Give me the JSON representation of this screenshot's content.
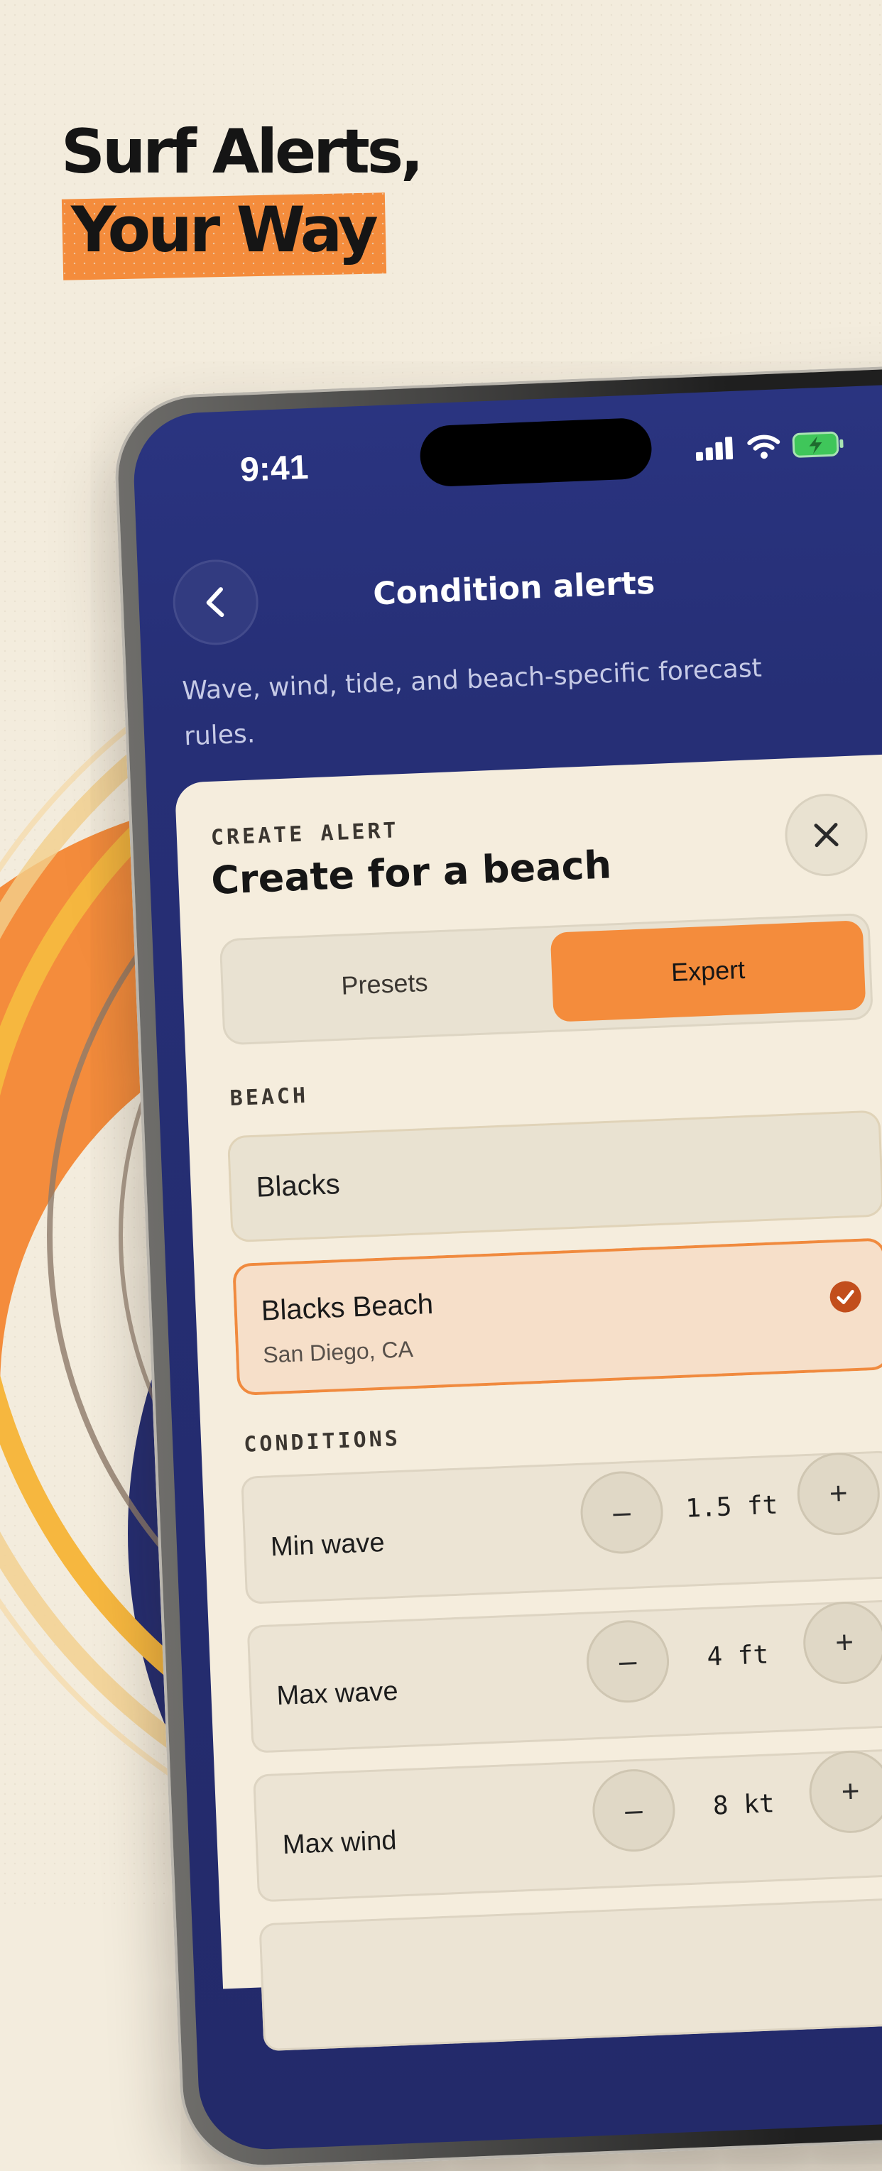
{
  "headline": {
    "line1": "Surf Alerts,",
    "line2": "Your Way"
  },
  "status_bar": {
    "time": "9:41"
  },
  "nav": {
    "title": "Condition alerts"
  },
  "subtitle": "Wave, wind, tide, and beach-specific forecast rules.",
  "sheet": {
    "label": "CREATE ALERT",
    "title": "Create for a beach",
    "tabs": [
      {
        "label": "Presets",
        "selected": false
      },
      {
        "label": "Expert",
        "selected": true
      }
    ],
    "beach_section": "BEACH",
    "beach_input_value": "Blacks",
    "result": {
      "name": "Blacks Beach",
      "location": "San Diego, CA"
    },
    "conditions_section": "CONDITIONS",
    "conditions": [
      {
        "label": "Min wave",
        "value": "1.5 ft",
        "minus": "–",
        "plus": "+"
      },
      {
        "label": "Max wave",
        "value": "4 ft",
        "minus": "–",
        "plus": "+"
      },
      {
        "label": "Max wind",
        "value": "8 kt",
        "minus": "–",
        "plus": "+"
      }
    ]
  },
  "colors": {
    "accent": "#f48c3c",
    "navy": "#252d72",
    "sheet": "#f5eddd",
    "background": "#f3ecdd",
    "battery": "#3fc65a"
  },
  "icons": [
    "back-chevron-icon",
    "close-icon",
    "check-icon",
    "signal-icon",
    "wifi-icon",
    "battery-charging-icon"
  ]
}
